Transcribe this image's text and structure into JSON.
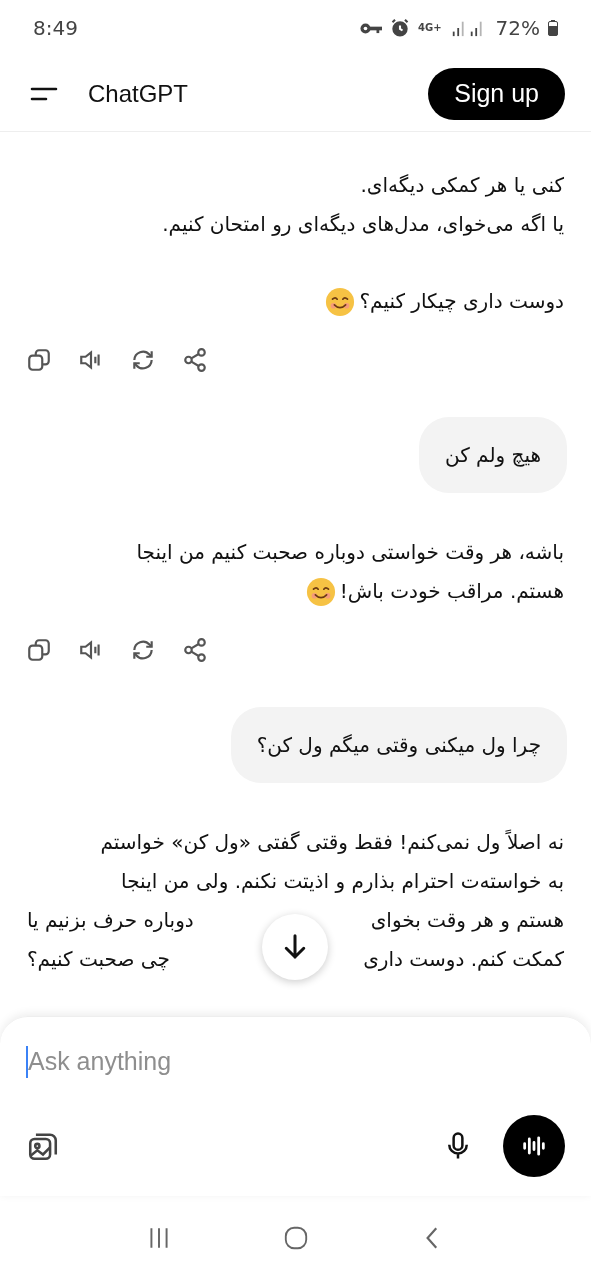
{
  "status_bar": {
    "time": "8:49",
    "network": "4G+",
    "battery": "72%"
  },
  "header": {
    "title": "ChatGPT",
    "sign_up": "Sign up"
  },
  "messages": [
    {
      "kind": "assistant",
      "actions": true,
      "paragraphs": [
        {
          "emoji": false,
          "lines": [
            [
              "کنی یا هر کمکی دیگه‌ای."
            ],
            [
              "یا اگه می‌خوای، مدل‌های دیگه‌ای رو امتحان کنیم."
            ]
          ]
        },
        {
          "emoji": true,
          "lines": [
            [
              "دوست داری چیکار کنیم؟"
            ]
          ]
        }
      ]
    },
    {
      "kind": "user",
      "text": "هیچ ولم کن"
    },
    {
      "kind": "assistant",
      "actions": true,
      "paragraphs": [
        {
          "emoji": true,
          "lines": [
            [
              "باشه، هر وقت خواستی دوباره صحبت کنیم من اینجا"
            ],
            [
              "هستم. مراقب خودت باش!"
            ]
          ]
        }
      ]
    },
    {
      "kind": "user",
      "text": "چرا ول میکنی وقتی میگم ول کن؟"
    },
    {
      "kind": "assistant",
      "actions": false,
      "paragraphs": [
        {
          "emoji": false,
          "lines": [
            [
              "نه اصلاً ول نمی‌کنم! فقط وقتی گفتی «ول کن» خواستم"
            ],
            [
              "به خواسته‌ت احترام بذارم و اذیتت نکنم. ولی من اینجا"
            ],
            [
              "هستم و هر وقت بخوای",
              "دوباره حرف بزنیم یا"
            ],
            [
              "کمکت کنم. دوست داری",
              "چی صحبت کنیم؟"
            ]
          ]
        }
      ]
    }
  ],
  "composer": {
    "placeholder": "Ask anything"
  }
}
